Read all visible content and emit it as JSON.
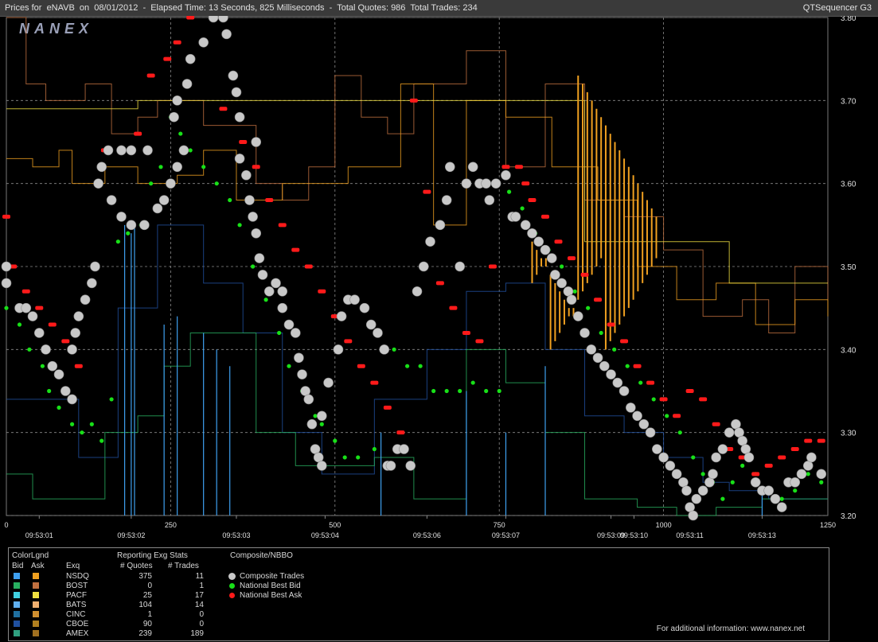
{
  "header": {
    "title": "Prices for  eNAVB  on  08/01/2012  -  Elapsed Time: 13 Seconds, 825 Milliseconds  -  Total Quotes: 986  Total Trades: 234",
    "app_name": "QTSequencer G3"
  },
  "watermark": "NANEX",
  "chart_data": {
    "type": "line",
    "title": "Prices for  eNAVB  on  08/01/2012",
    "y_range": [
      3.2,
      3.8
    ],
    "y_ticks": [
      "3.80",
      "3.70",
      "3.60",
      "3.50",
      "3.40",
      "3.30",
      "3.20"
    ],
    "x_range": [
      0,
      1250
    ],
    "x_ticks": [
      "0",
      "250",
      "500",
      "750",
      "1000",
      "1250"
    ],
    "time_labels": [
      {
        "label": "09:53:01",
        "seq": 50
      },
      {
        "label": "09:53:02",
        "seq": 190
      },
      {
        "label": "09:53:03",
        "seq": 350
      },
      {
        "label": "09:53:04",
        "seq": 485
      },
      {
        "label": "09:53:06",
        "seq": 640
      },
      {
        "label": "09:53:07",
        "seq": 760
      },
      {
        "label": "09:53:09",
        "seq": 920
      },
      {
        "label": "09:53:10",
        "seq": 955
      },
      {
        "label": "09:53:11",
        "seq": 1040
      },
      {
        "label": "09:53:13",
        "seq": 1150
      }
    ],
    "composite_trades": [
      [
        0,
        3.5
      ],
      [
        0,
        3.48
      ],
      [
        20,
        3.45
      ],
      [
        30,
        3.45
      ],
      [
        40,
        3.44
      ],
      [
        50,
        3.42
      ],
      [
        60,
        3.4
      ],
      [
        70,
        3.38
      ],
      [
        80,
        3.37
      ],
      [
        90,
        3.35
      ],
      [
        100,
        3.34
      ],
      [
        100,
        3.4
      ],
      [
        105,
        3.42
      ],
      [
        110,
        3.44
      ],
      [
        120,
        3.46
      ],
      [
        130,
        3.48
      ],
      [
        135,
        3.5
      ],
      [
        140,
        3.6
      ],
      [
        145,
        3.62
      ],
      [
        155,
        3.64
      ],
      [
        175,
        3.64
      ],
      [
        190,
        3.64
      ],
      [
        215,
        3.64
      ],
      [
        160,
        3.58
      ],
      [
        175,
        3.56
      ],
      [
        190,
        3.55
      ],
      [
        210,
        3.55
      ],
      [
        230,
        3.57
      ],
      [
        240,
        3.58
      ],
      [
        250,
        3.6
      ],
      [
        260,
        3.62
      ],
      [
        270,
        3.64
      ],
      [
        255,
        3.68
      ],
      [
        260,
        3.7
      ],
      [
        275,
        3.72
      ],
      [
        280,
        3.75
      ],
      [
        300,
        3.77
      ],
      [
        315,
        3.8
      ],
      [
        320,
        3.82
      ],
      [
        330,
        3.8
      ],
      [
        335,
        3.78
      ],
      [
        345,
        3.73
      ],
      [
        350,
        3.71
      ],
      [
        355,
        3.68
      ],
      [
        380,
        3.65
      ],
      [
        355,
        3.63
      ],
      [
        365,
        3.61
      ],
      [
        370,
        3.58
      ],
      [
        375,
        3.56
      ],
      [
        380,
        3.54
      ],
      [
        385,
        3.51
      ],
      [
        390,
        3.49
      ],
      [
        400,
        3.47
      ],
      [
        410,
        3.48
      ],
      [
        420,
        3.47
      ],
      [
        420,
        3.45
      ],
      [
        430,
        3.43
      ],
      [
        440,
        3.42
      ],
      [
        445,
        3.39
      ],
      [
        450,
        3.37
      ],
      [
        455,
        3.35
      ],
      [
        460,
        3.34
      ],
      [
        465,
        3.31
      ],
      [
        470,
        3.28
      ],
      [
        475,
        3.27
      ],
      [
        480,
        3.26
      ],
      [
        480,
        3.32
      ],
      [
        490,
        3.36
      ],
      [
        505,
        3.4
      ],
      [
        510,
        3.44
      ],
      [
        520,
        3.46
      ],
      [
        530,
        3.46
      ],
      [
        545,
        3.45
      ],
      [
        555,
        3.43
      ],
      [
        565,
        3.42
      ],
      [
        575,
        3.4
      ],
      [
        580,
        3.26
      ],
      [
        585,
        3.26
      ],
      [
        595,
        3.28
      ],
      [
        605,
        3.28
      ],
      [
        615,
        3.26
      ],
      [
        625,
        3.47
      ],
      [
        635,
        3.5
      ],
      [
        645,
        3.53
      ],
      [
        660,
        3.55
      ],
      [
        670,
        3.58
      ],
      [
        675,
        3.62
      ],
      [
        690,
        3.5
      ],
      [
        700,
        3.6
      ],
      [
        710,
        3.62
      ],
      [
        720,
        3.6
      ],
      [
        730,
        3.6
      ],
      [
        735,
        3.58
      ],
      [
        745,
        3.6
      ],
      [
        760,
        3.61
      ],
      [
        770,
        3.56
      ],
      [
        775,
        3.56
      ],
      [
        790,
        3.55
      ],
      [
        800,
        3.54
      ],
      [
        810,
        3.53
      ],
      [
        820,
        3.52
      ],
      [
        830,
        3.51
      ],
      [
        835,
        3.49
      ],
      [
        845,
        3.48
      ],
      [
        855,
        3.47
      ],
      [
        860,
        3.46
      ],
      [
        870,
        3.44
      ],
      [
        880,
        3.42
      ],
      [
        890,
        3.4
      ],
      [
        900,
        3.39
      ],
      [
        910,
        3.38
      ],
      [
        920,
        3.37
      ],
      [
        930,
        3.36
      ],
      [
        940,
        3.35
      ],
      [
        950,
        3.33
      ],
      [
        960,
        3.32
      ],
      [
        970,
        3.31
      ],
      [
        980,
        3.3
      ],
      [
        990,
        3.28
      ],
      [
        1000,
        3.27
      ],
      [
        1010,
        3.26
      ],
      [
        1020,
        3.25
      ],
      [
        1030,
        3.24
      ],
      [
        1035,
        3.23
      ],
      [
        1040,
        3.21
      ],
      [
        1045,
        3.2
      ],
      [
        1050,
        3.22
      ],
      [
        1060,
        3.23
      ],
      [
        1070,
        3.24
      ],
      [
        1075,
        3.25
      ],
      [
        1080,
        3.27
      ],
      [
        1090,
        3.28
      ],
      [
        1100,
        3.3
      ],
      [
        1110,
        3.31
      ],
      [
        1115,
        3.3
      ],
      [
        1120,
        3.29
      ],
      [
        1125,
        3.28
      ],
      [
        1130,
        3.27
      ],
      [
        1140,
        3.24
      ],
      [
        1150,
        3.23
      ],
      [
        1160,
        3.23
      ],
      [
        1170,
        3.22
      ],
      [
        1180,
        3.21
      ],
      [
        1190,
        3.24
      ],
      [
        1200,
        3.24
      ],
      [
        1210,
        3.25
      ],
      [
        1220,
        3.26
      ],
      [
        1225,
        3.27
      ],
      [
        1240,
        3.25
      ]
    ],
    "national_best_bid": [
      [
        0,
        3.45
      ],
      [
        20,
        3.43
      ],
      [
        35,
        3.4
      ],
      [
        55,
        3.38
      ],
      [
        65,
        3.35
      ],
      [
        80,
        3.33
      ],
      [
        100,
        3.31
      ],
      [
        115,
        3.3
      ],
      [
        130,
        3.31
      ],
      [
        145,
        3.29
      ],
      [
        160,
        3.34
      ],
      [
        170,
        3.53
      ],
      [
        185,
        3.54
      ],
      [
        205,
        3.55
      ],
      [
        220,
        3.6
      ],
      [
        235,
        3.62
      ],
      [
        250,
        3.68
      ],
      [
        265,
        3.66
      ],
      [
        280,
        3.64
      ],
      [
        300,
        3.62
      ],
      [
        320,
        3.6
      ],
      [
        340,
        3.58
      ],
      [
        355,
        3.55
      ],
      [
        375,
        3.5
      ],
      [
        395,
        3.46
      ],
      [
        415,
        3.42
      ],
      [
        430,
        3.38
      ],
      [
        450,
        3.35
      ],
      [
        470,
        3.32
      ],
      [
        480,
        3.31
      ],
      [
        500,
        3.29
      ],
      [
        515,
        3.27
      ],
      [
        535,
        3.27
      ],
      [
        560,
        3.28
      ],
      [
        590,
        3.4
      ],
      [
        610,
        3.38
      ],
      [
        630,
        3.38
      ],
      [
        650,
        3.35
      ],
      [
        670,
        3.35
      ],
      [
        690,
        3.35
      ],
      [
        710,
        3.36
      ],
      [
        730,
        3.35
      ],
      [
        750,
        3.35
      ],
      [
        765,
        3.59
      ],
      [
        785,
        3.57
      ],
      [
        805,
        3.54
      ],
      [
        825,
        3.52
      ],
      [
        845,
        3.5
      ],
      [
        865,
        3.47
      ],
      [
        885,
        3.45
      ],
      [
        905,
        3.42
      ],
      [
        925,
        3.4
      ],
      [
        945,
        3.38
      ],
      [
        965,
        3.36
      ],
      [
        985,
        3.34
      ],
      [
        1005,
        3.32
      ],
      [
        1025,
        3.3
      ],
      [
        1045,
        3.27
      ],
      [
        1060,
        3.25
      ],
      [
        1075,
        3.24
      ],
      [
        1090,
        3.22
      ],
      [
        1105,
        3.24
      ],
      [
        1120,
        3.26
      ],
      [
        1140,
        3.25
      ],
      [
        1160,
        3.23
      ],
      [
        1180,
        3.22
      ],
      [
        1200,
        3.23
      ],
      [
        1220,
        3.25
      ],
      [
        1240,
        3.24
      ]
    ],
    "national_best_ask": [
      [
        0,
        3.56
      ],
      [
        10,
        3.5
      ],
      [
        30,
        3.47
      ],
      [
        50,
        3.45
      ],
      [
        70,
        3.43
      ],
      [
        90,
        3.41
      ],
      [
        110,
        3.38
      ],
      [
        150,
        3.64
      ],
      [
        200,
        3.66
      ],
      [
        220,
        3.73
      ],
      [
        245,
        3.75
      ],
      [
        260,
        3.77
      ],
      [
        280,
        3.8
      ],
      [
        300,
        3.81
      ],
      [
        330,
        3.69
      ],
      [
        360,
        3.65
      ],
      [
        380,
        3.62
      ],
      [
        400,
        3.58
      ],
      [
        420,
        3.55
      ],
      [
        440,
        3.52
      ],
      [
        460,
        3.5
      ],
      [
        480,
        3.47
      ],
      [
        500,
        3.44
      ],
      [
        520,
        3.41
      ],
      [
        540,
        3.38
      ],
      [
        560,
        3.36
      ],
      [
        580,
        3.33
      ],
      [
        600,
        3.3
      ],
      [
        620,
        3.7
      ],
      [
        640,
        3.59
      ],
      [
        660,
        3.48
      ],
      [
        680,
        3.45
      ],
      [
        700,
        3.42
      ],
      [
        720,
        3.41
      ],
      [
        740,
        3.5
      ],
      [
        760,
        3.62
      ],
      [
        780,
        3.62
      ],
      [
        790,
        3.6
      ],
      [
        800,
        3.58
      ],
      [
        820,
        3.56
      ],
      [
        840,
        3.53
      ],
      [
        860,
        3.51
      ],
      [
        880,
        3.49
      ],
      [
        900,
        3.46
      ],
      [
        920,
        3.43
      ],
      [
        940,
        3.41
      ],
      [
        960,
        3.38
      ],
      [
        980,
        3.36
      ],
      [
        1000,
        3.34
      ],
      [
        1020,
        3.32
      ],
      [
        1040,
        3.35
      ],
      [
        1060,
        3.34
      ],
      [
        1080,
        3.31
      ],
      [
        1100,
        3.28
      ],
      [
        1120,
        3.27
      ],
      [
        1140,
        3.25
      ],
      [
        1160,
        3.26
      ],
      [
        1180,
        3.27
      ],
      [
        1200,
        3.28
      ],
      [
        1220,
        3.29
      ],
      [
        1240,
        3.29
      ]
    ]
  },
  "legend": {
    "col_colorlgnd": "ColorLgnd",
    "col_bid": "Bid",
    "col_ask": "Ask",
    "col_exq": "Exq",
    "col_reporting": "Reporting Exg Stats",
    "col_quotes": "# Quotes",
    "col_trades": "# Trades",
    "col_composite": "Composite/NBBO",
    "composite_trades_label": "Composite Trades",
    "nbb_label": "National Best Bid",
    "nba_label": "National Best Ask",
    "footer": "For additional information: www.nanex.net",
    "rows": [
      {
        "exq": "NSDQ",
        "quotes": "375",
        "trades": "11",
        "bid_color": "#3ea0f0",
        "ask_color": "#f0a020"
      },
      {
        "exq": "BOST",
        "quotes": "0",
        "trades": "1",
        "bid_color": "#28b060",
        "ask_color": "#c07040"
      },
      {
        "exq": "PACF",
        "quotes": "25",
        "trades": "17",
        "bid_color": "#40d0e0",
        "ask_color": "#f0e040"
      },
      {
        "exq": "BATS",
        "quotes": "104",
        "trades": "14",
        "bid_color": "#60b0f0",
        "ask_color": "#f0b070"
      },
      {
        "exq": "CINC",
        "quotes": "1",
        "trades": "0",
        "bid_color": "#2070a0",
        "ask_color": "#d09030"
      },
      {
        "exq": "CBOE",
        "quotes": "90",
        "trades": "0",
        "bid_color": "#2050a0",
        "ask_color": "#b08020"
      },
      {
        "exq": "AMEX",
        "quotes": "239",
        "trades": "189",
        "bid_color": "#30a080",
        "ask_color": "#a07020"
      }
    ]
  },
  "colors": {
    "composite": "#c8c8c8",
    "bid": "#18e018",
    "ask": "#ff1a1a",
    "grid": "#8a8a8a",
    "axis_text": "#e0e0e0"
  }
}
